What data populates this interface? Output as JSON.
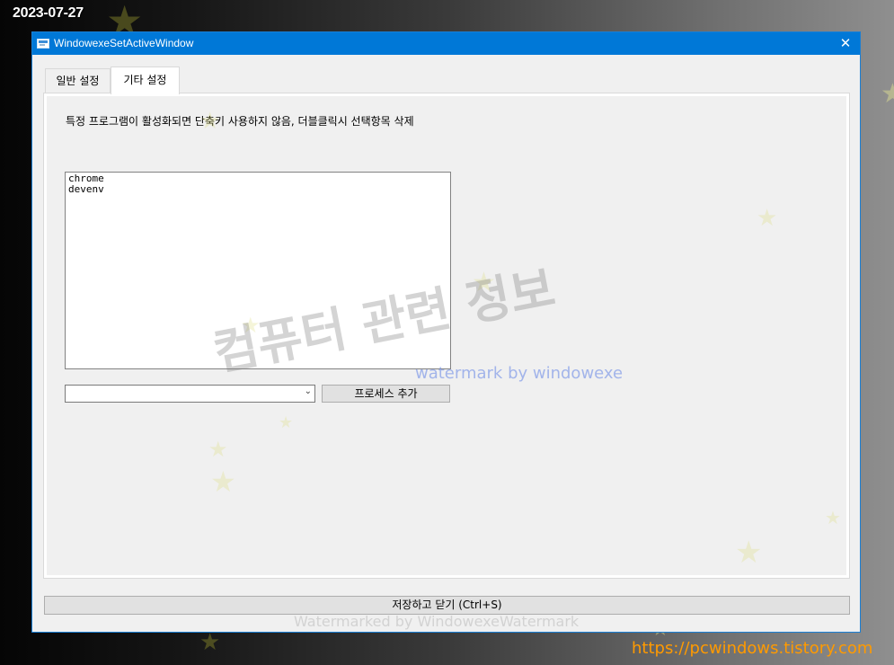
{
  "desktop": {
    "date_overlay": "2023-07-27",
    "site_url": "https://pcwindows.tistory.com"
  },
  "window": {
    "title": "WindowexeSetActiveWindow",
    "close_glyph": "✕",
    "icon": "app-window-icon"
  },
  "tabs": [
    {
      "label": "일반 설정",
      "selected": false
    },
    {
      "label": "기타 설정",
      "selected": true
    }
  ],
  "panel": {
    "description": "특정 프로그램이 활성화되면 단축키 사용하지 않음, 더블클릭시 선택항목 삭제",
    "process_list": [
      "chrome",
      "devenv"
    ],
    "combo_value": "",
    "add_button_label": "프로세스 추가"
  },
  "footer": {
    "save_button_label": "저장하고 닫기 (Ctrl+S)"
  },
  "watermarks": {
    "korean": "컴퓨터 관련 정보",
    "english": "watermark by windowexe",
    "bottom": "Watermarked by WindowexeWatermark"
  },
  "colors": {
    "titlebar": "#0078d7",
    "accent_url": "#ff9a00"
  }
}
